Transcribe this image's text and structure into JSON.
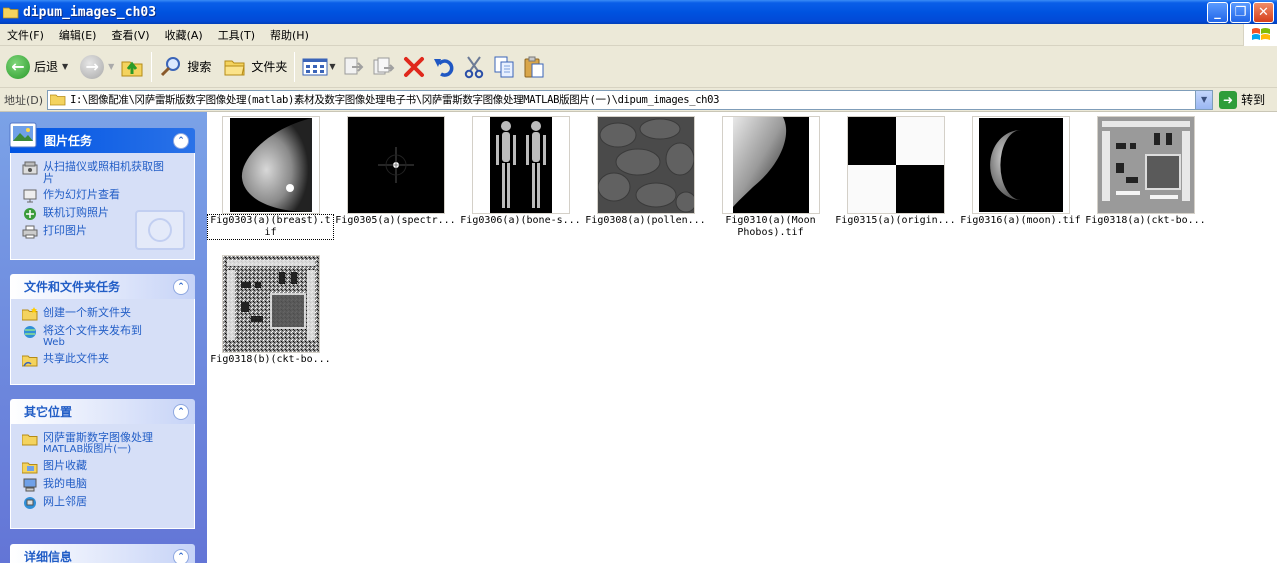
{
  "window": {
    "title": "dipum_images_ch03",
    "buttons": {
      "minimize": "_",
      "maximize": "❐",
      "close": "✕"
    }
  },
  "menu": [
    "文件(F)",
    "编辑(E)",
    "查看(V)",
    "收藏(A)",
    "工具(T)",
    "帮助(H)"
  ],
  "toolbar": {
    "back_label": "后退",
    "search_label": "搜索",
    "folders_label": "文件夹"
  },
  "address": {
    "label": "地址(D)",
    "path": "I:\\图像配准\\冈萨雷斯版数字图像处理(matlab)素材及数字图像处理电子书\\冈萨雷斯数字图像处理MATLAB版图片(一)\\dipum_images_ch03",
    "go_label": "转到"
  },
  "sidebar": {
    "picture_tasks": {
      "title": "图片任务",
      "items": [
        {
          "label": "从扫描仪或照相机获取图片",
          "icon": "scanner-icon"
        },
        {
          "label": "作为幻灯片查看",
          "icon": "slideshow-icon"
        },
        {
          "label": "联机订购照片",
          "icon": "order-prints-icon"
        },
        {
          "label": "打印图片",
          "icon": "printer-icon"
        }
      ]
    },
    "file_tasks": {
      "title": "文件和文件夹任务",
      "items": [
        {
          "label": "创建一个新文件夹",
          "sub": "",
          "icon": "new-folder-icon"
        },
        {
          "label": "将这个文件夹发布到",
          "sub": "Web",
          "icon": "publish-web-icon"
        },
        {
          "label": "共享此文件夹",
          "sub": "",
          "icon": "share-folder-icon"
        }
      ]
    },
    "other_places": {
      "title": "其它位置",
      "items": [
        {
          "label": "冈萨雷斯数字图像处理",
          "sub": "MATLAB版图片(一)",
          "icon": "folder-icon"
        },
        {
          "label": "图片收藏",
          "sub": "",
          "icon": "my-pictures-icon"
        },
        {
          "label": "我的电脑",
          "sub": "",
          "icon": "my-computer-icon"
        },
        {
          "label": "网上邻居",
          "sub": "",
          "icon": "network-icon"
        }
      ]
    },
    "details": {
      "title": "详细信息"
    }
  },
  "files": [
    {
      "name": "Fig0303(a)(breast).tif",
      "line1": "Fig0303(a)(breast).t",
      "line2": "if",
      "selected": true
    },
    {
      "name": "Fig0305(a)(spectr...",
      "line1": "Fig0305(a)(spectr...",
      "line2": ""
    },
    {
      "name": "Fig0306(a)(bone-s...",
      "line1": "Fig0306(a)(bone-s...",
      "line2": ""
    },
    {
      "name": "Fig0308(a)(pollen...",
      "line1": "Fig0308(a)(pollen...",
      "line2": ""
    },
    {
      "name": "Fig0310(a)(Moon Phobos).tif",
      "line1": "Fig0310(a)(Moon",
      "line2": "Phobos).tif"
    },
    {
      "name": "Fig0315(a)(origin...",
      "line1": "Fig0315(a)(origin...",
      "line2": ""
    },
    {
      "name": "Fig0316(a)(moon).tif",
      "line1": "Fig0316(a)(moon).tif",
      "line2": ""
    },
    {
      "name": "Fig0318(a)(ckt-bo...",
      "line1": "Fig0318(a)(ckt-bo...",
      "line2": ""
    },
    {
      "name": "Fig0318(b)(ckt-bo...",
      "line1": "Fig0318(b)(ckt-bo...",
      "line2": ""
    }
  ]
}
